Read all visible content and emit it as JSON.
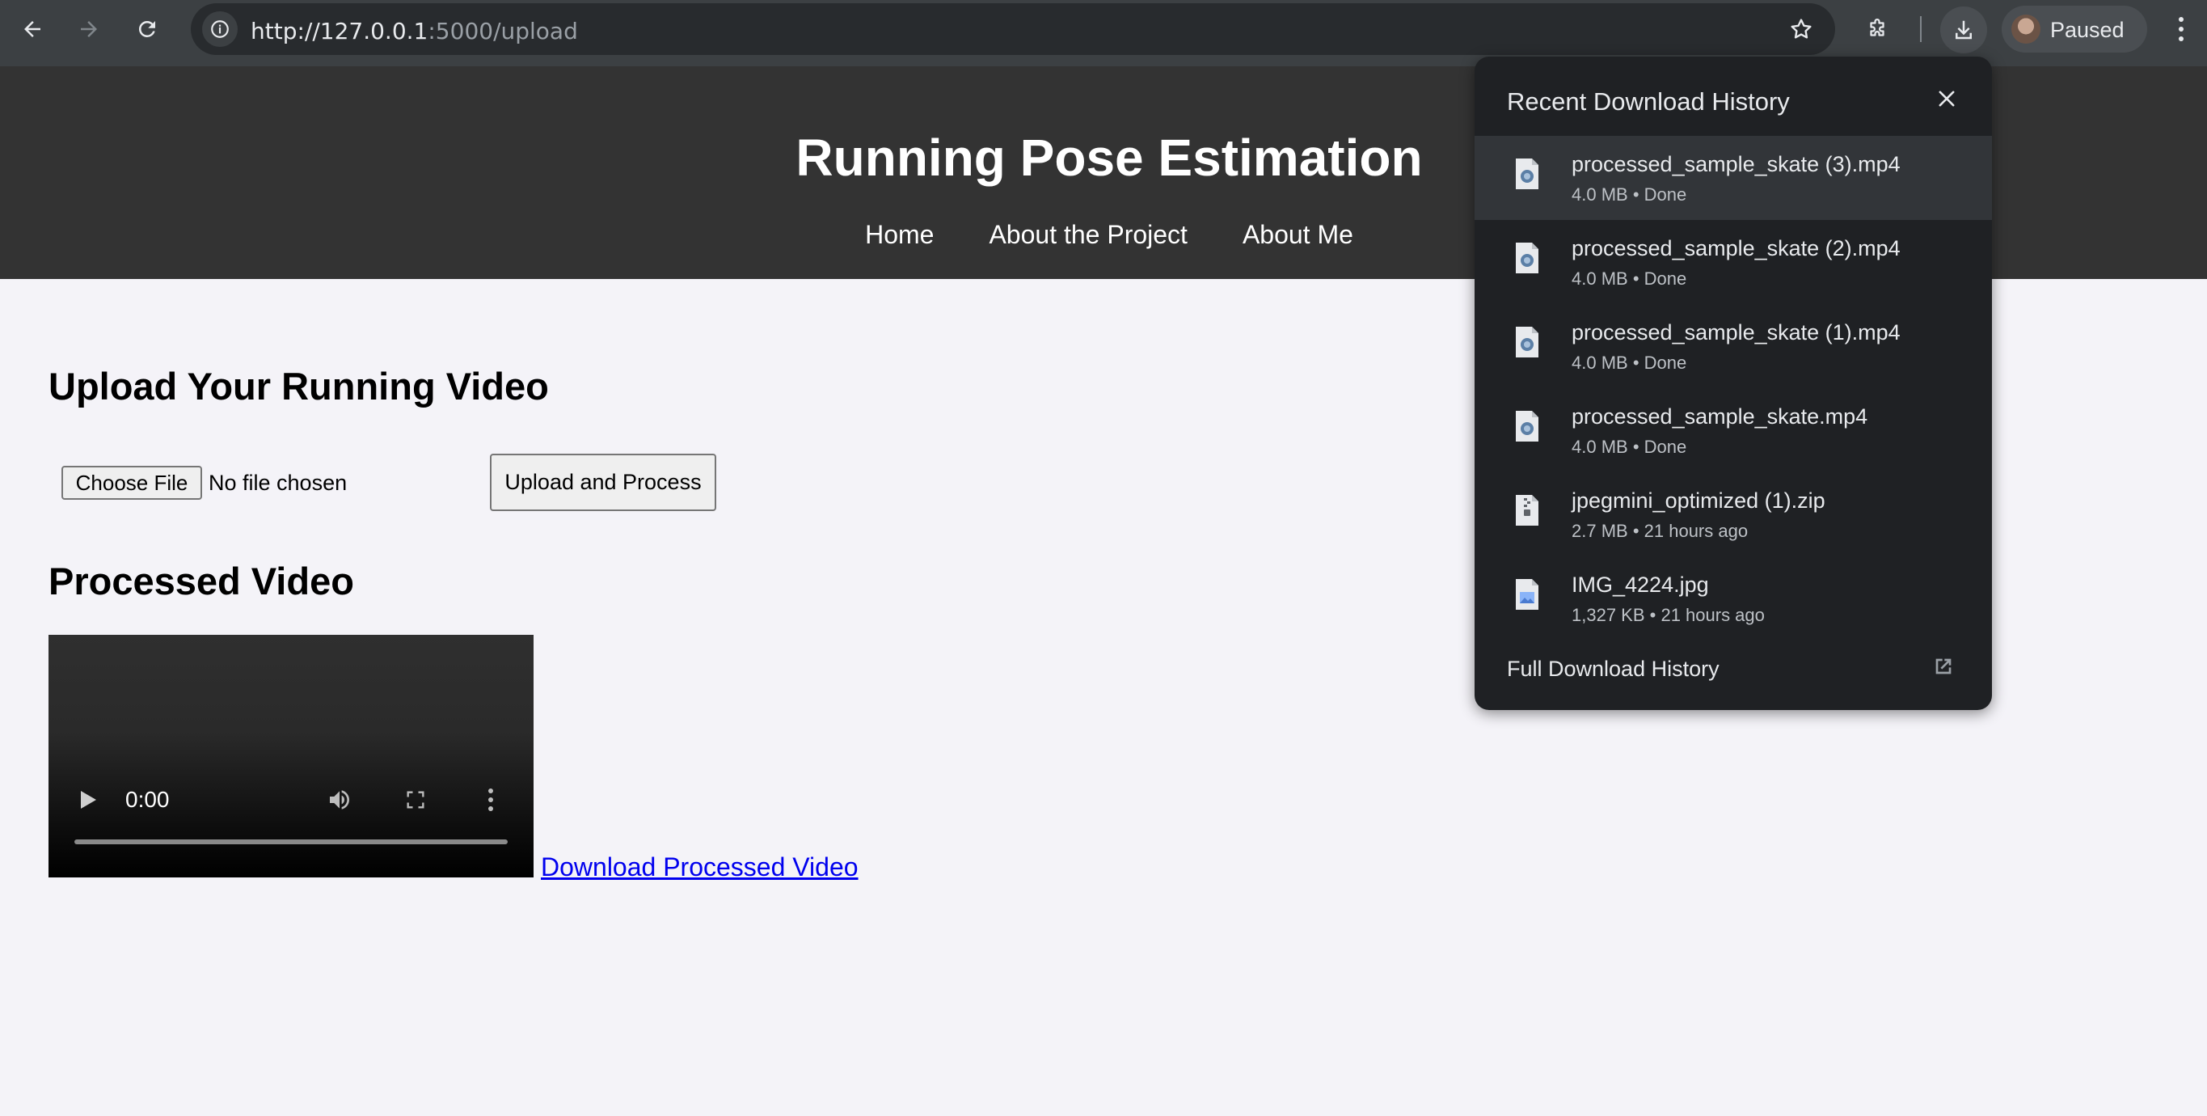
{
  "browser": {
    "url_host": "http://127.0.0.1",
    "url_rest": ":5000/upload",
    "profile_status": "Paused"
  },
  "site": {
    "title": "Running Pose Estimation",
    "nav": [
      "Home",
      "About the Project",
      "About Me"
    ]
  },
  "upload": {
    "heading": "Upload Your Running Video",
    "choose_file_label": "Choose File",
    "no_file_text": "No file chosen",
    "submit_label": "Upload and Process"
  },
  "processed": {
    "heading": "Processed Video",
    "video_time": "0:00",
    "video_progress": 0,
    "download_link": "Download Processed Video"
  },
  "downloads_popup": {
    "title": "Recent Download History",
    "items": [
      {
        "name": "processed_sample_skate (3).mp4",
        "size": "4.0 MB",
        "status": "Done",
        "icon": "video-file-icon"
      },
      {
        "name": "processed_sample_skate (2).mp4",
        "size": "4.0 MB",
        "status": "Done",
        "icon": "video-file-icon"
      },
      {
        "name": "processed_sample_skate (1).mp4",
        "size": "4.0 MB",
        "status": "Done",
        "icon": "video-file-icon"
      },
      {
        "name": "processed_sample_skate.mp4",
        "size": "4.0 MB",
        "status": "Done",
        "icon": "video-file-icon"
      },
      {
        "name": "jpegmini_optimized (1).zip",
        "size": "2.7 MB",
        "status": "21 hours ago",
        "icon": "zip-file-icon"
      },
      {
        "name": "IMG_4224.jpg",
        "size": "1,327 KB",
        "status": "21 hours ago",
        "icon": "image-file-icon"
      }
    ],
    "full_history_label": "Full Download History"
  }
}
